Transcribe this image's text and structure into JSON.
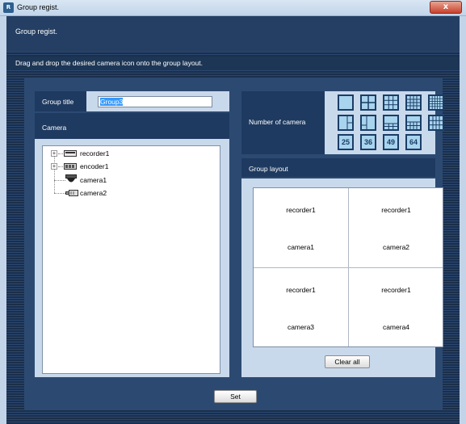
{
  "window": {
    "title": "Group regist.",
    "close_label": "x"
  },
  "header": {
    "title": "Group regist."
  },
  "instruction": "Drag and drop the desired camera icon onto the group layout.",
  "group_title": {
    "label": "Group title",
    "value": "Group3"
  },
  "camera_panel": {
    "label": "Camera",
    "tree": [
      {
        "label": "recorder1",
        "expander": "+",
        "icon": "recorder-icon"
      },
      {
        "label": "encoder1",
        "expander": "+",
        "icon": "encoder-icon"
      },
      {
        "label": "camera1",
        "icon": "dome-camera-icon"
      },
      {
        "label": "camera2",
        "icon": "box-camera-icon"
      }
    ]
  },
  "number_of_camera": {
    "label": "Number of camera",
    "numeric_options": [
      "25",
      "36",
      "49",
      "64"
    ]
  },
  "group_layout": {
    "label": "Group layout",
    "cells": [
      {
        "recorder": "recorder1",
        "camera": "camera1"
      },
      {
        "recorder": "recorder1",
        "camera": "camera2"
      },
      {
        "recorder": "recorder1",
        "camera": "camera3"
      },
      {
        "recorder": "recorder1",
        "camera": "camera4"
      }
    ],
    "clear_all_label": "Clear all"
  },
  "set_label": "Set"
}
